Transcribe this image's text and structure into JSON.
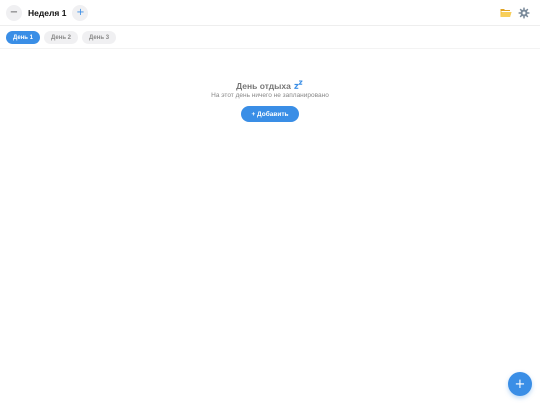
{
  "header": {
    "prev_week_label": "−",
    "week_title": "Неделя 1",
    "next_week_label": "+",
    "folder_icon": "folder-open-icon",
    "settings_icon": "gear-icon"
  },
  "tabs": [
    {
      "label": "День 1",
      "active": true
    },
    {
      "label": "День 2",
      "active": false
    },
    {
      "label": "День 3",
      "active": false
    }
  ],
  "empty_state": {
    "title": "День отдыха",
    "title_icon": "sleep-zzz-icon",
    "subtitle": "На этот день ничего не запланировано",
    "add_label": "+ Добавить"
  },
  "fab": {
    "label": "+"
  },
  "colors": {
    "accent": "#3a8ee6",
    "tab_inactive_bg": "#f0f0f2",
    "tab_inactive_text": "#888888",
    "muted_text": "#777777"
  }
}
